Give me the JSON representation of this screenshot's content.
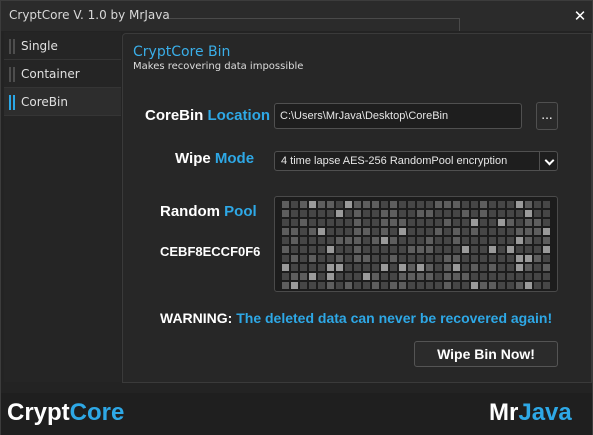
{
  "window": {
    "title": "CryptCore V. 1.0 by MrJava"
  },
  "sidebar": {
    "items": [
      {
        "label": "Single",
        "active": false
      },
      {
        "label": "Container",
        "active": false
      },
      {
        "label": "CoreBin",
        "active": true
      }
    ]
  },
  "panel": {
    "title": "CryptCore Bin",
    "subtitle": "Makes recovering data impossible",
    "location": {
      "label_white": "CoreBin",
      "label_blue": "Location",
      "value": "C:\\Users\\MrJava\\Desktop\\CoreBin",
      "browse_label": "..."
    },
    "wipe_mode": {
      "label_white": "Wipe",
      "label_blue": "Mode",
      "value": "4 time lapse AES-256 RandomPool encryption"
    },
    "pool": {
      "label_white": "Random",
      "label_blue": "Pool",
      "hex_value": "CEBF8ECCF0F6"
    },
    "warning": {
      "prefix": "WARNING:",
      "message": "The deleted data can never be recovered again!"
    },
    "wipe_button": "Wipe Bin Now!"
  },
  "footer": {
    "left_brand": {
      "white": "Crypt",
      "blue": "Core"
    },
    "right_brand": {
      "white": "Mr",
      "blue": "Java"
    }
  },
  "colors": {
    "accent": "#2ea8e6",
    "background": "#232323",
    "text": "#ffffff"
  },
  "icons": {
    "close": "close-icon",
    "browse": "ellipsis-icon",
    "dropdown": "chevron-down-icon"
  }
}
